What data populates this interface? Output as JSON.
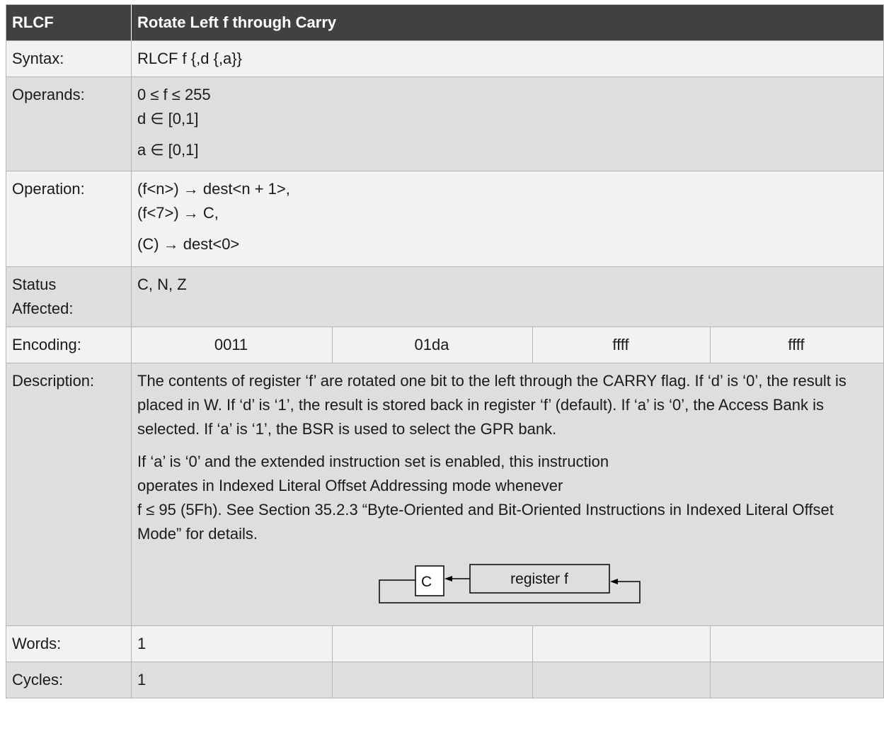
{
  "header": {
    "mnemonic": "RLCF",
    "title": "Rotate Left f through Carry"
  },
  "rows": {
    "syntax": {
      "label": "Syntax:",
      "value": "RLCF f {,d {,a}}"
    },
    "operands": {
      "label": "Operands:",
      "lines": [
        "0 ≤ f ≤ 255",
        "d ∈ [0,1]",
        "a ∈ [0,1]"
      ]
    },
    "operation": {
      "label": "Operation:",
      "lines": [
        "(f<n>) → dest<n + 1>,",
        "(f<7>) → C,",
        "(C) → dest<0>"
      ]
    },
    "status": {
      "label_line1": "Status",
      "label_line2": "Affected:",
      "value": "C, N, Z"
    },
    "encoding": {
      "label": "Encoding:",
      "fields": [
        "0011",
        "01da",
        "ffff",
        "ffff"
      ]
    },
    "description": {
      "label": "Description:",
      "paragraph1": "The contents of register ‘f’ are rotated one bit to the left through the CARRY flag. If ‘d’ is ‘0’, the result is placed in W. If ‘d’ is ‘1’, the result is stored back in register ‘f’ (default). If ‘a’ is ‘0’, the Access Bank is selected. If ‘a’ is ‘1’, the BSR is used to select the GPR bank.",
      "paragraph2_lines": [
        "If ‘a’ is ‘0’ and the extended instruction set is enabled, this instruction",
        "operates in Indexed Literal Offset Addressing mode whenever",
        "f ≤ 95 (5Fh). See Section 35.2.3 “Byte-Oriented and Bit-Oriented Instructions in Indexed Literal Offset Mode” for details."
      ],
      "diagram": {
        "carry_label": "C",
        "register_label": "register f"
      }
    },
    "words": {
      "label": "Words:",
      "value": "1"
    },
    "cycles": {
      "label": "Cycles:",
      "value": "1"
    }
  },
  "colors": {
    "header_bg": "#414141",
    "row_light": "#f2f2f2",
    "row_dark": "#dedede",
    "border": "#b5b5b5"
  }
}
